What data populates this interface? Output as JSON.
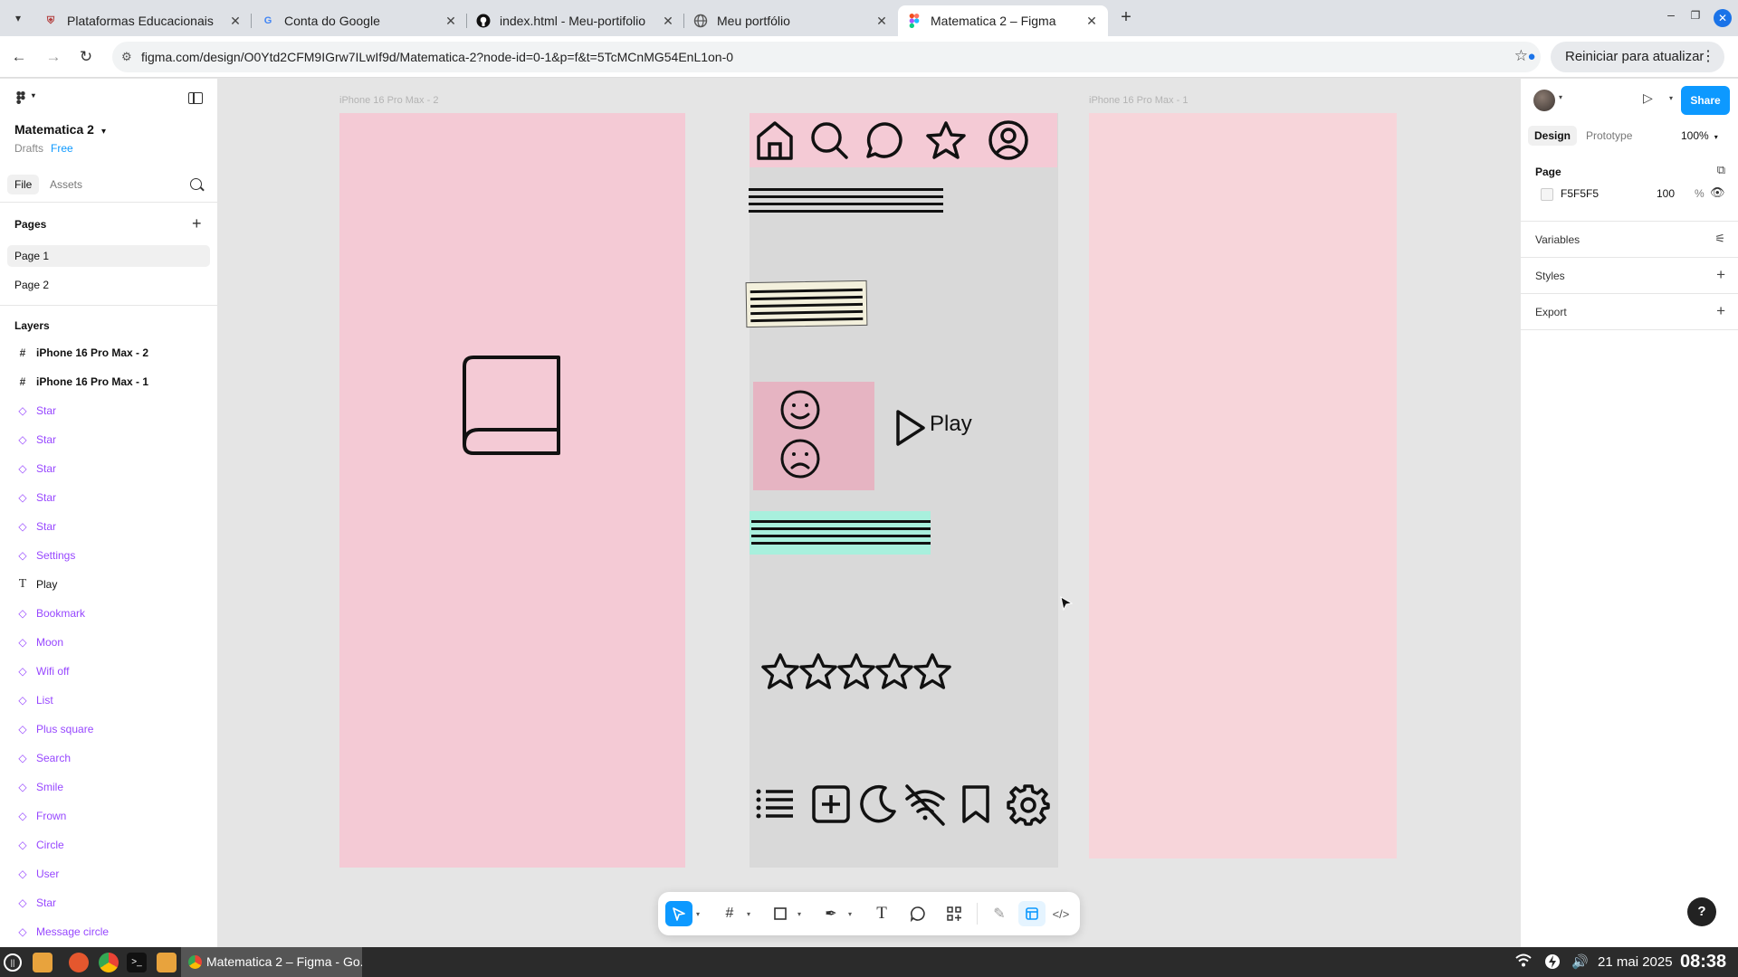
{
  "browser": {
    "tabs": [
      {
        "title": "Plataformas Educacionais",
        "favicon": "shield-icon"
      },
      {
        "title": "Conta do Google",
        "favicon": "google-icon"
      },
      {
        "title": "index.html - Meu-portifolio",
        "favicon": "github-icon"
      },
      {
        "title": "Meu portfólio",
        "favicon": "globe-icon"
      },
      {
        "title": "Matematica 2 – Figma",
        "favicon": "figma-icon"
      }
    ],
    "active_tab": 4,
    "url": "figma.com/design/O0Ytd2CFM9IGrw7ILwIf9d/Matematica-2?node-id=0-1&p=f&t=5TcMCnMG54EnL1on-0",
    "restart_label": "Reiniciar para atualizar"
  },
  "file": {
    "name": "Matematica 2",
    "location": "Drafts",
    "plan": "Free"
  },
  "left_panel": {
    "tab_file": "File",
    "tab_assets": "Assets",
    "pages_heading": "Pages",
    "pages": [
      "Page 1",
      "Page 2"
    ],
    "selected_page": 0,
    "layers_heading": "Layers",
    "layers": [
      {
        "name": "iPhone 16 Pro Max - 2",
        "kind": "frame"
      },
      {
        "name": "iPhone 16 Pro Max - 1",
        "kind": "frame"
      },
      {
        "name": "Star",
        "kind": "component"
      },
      {
        "name": "Star",
        "kind": "component"
      },
      {
        "name": "Star",
        "kind": "component"
      },
      {
        "name": "Star",
        "kind": "component"
      },
      {
        "name": "Star",
        "kind": "component"
      },
      {
        "name": "Settings",
        "kind": "component"
      },
      {
        "name": "Play",
        "kind": "text"
      },
      {
        "name": "Bookmark",
        "kind": "component"
      },
      {
        "name": "Moon",
        "kind": "component"
      },
      {
        "name": "Wifi off",
        "kind": "component"
      },
      {
        "name": "List",
        "kind": "component"
      },
      {
        "name": "Plus square",
        "kind": "component"
      },
      {
        "name": "Search",
        "kind": "component"
      },
      {
        "name": "Smile",
        "kind": "component"
      },
      {
        "name": "Frown",
        "kind": "component"
      },
      {
        "name": "Circle",
        "kind": "component"
      },
      {
        "name": "User",
        "kind": "component"
      },
      {
        "name": "Star",
        "kind": "component"
      },
      {
        "name": "Message circle",
        "kind": "component"
      }
    ]
  },
  "canvas": {
    "frame_left_label": "iPhone 16 Pro Max - 2",
    "frame_right_label": "iPhone 16 Pro Max - 1",
    "play_text": "Play",
    "frame_colors": {
      "pink": "#f4cad5",
      "gray": "#d9d9d9",
      "teal": "#a8f0dd",
      "emoji_box": "#e6b4c2"
    }
  },
  "right_panel": {
    "share_label": "Share",
    "tab_design": "Design",
    "tab_prototype": "Prototype",
    "zoom": "100%",
    "page_heading": "Page",
    "page_color": "F5F5F5",
    "page_opacity": "100",
    "percent_sign": "%",
    "variables_label": "Variables",
    "styles_label": "Styles",
    "export_label": "Export",
    "help_label": "?"
  },
  "taskbar": {
    "active_app": "Matematica 2 – Figma - Go...",
    "date": "21 mai 2025",
    "time": "08:38"
  },
  "colors": {
    "figma_blue": "#0d99ff",
    "component_purple": "#9747ff"
  }
}
